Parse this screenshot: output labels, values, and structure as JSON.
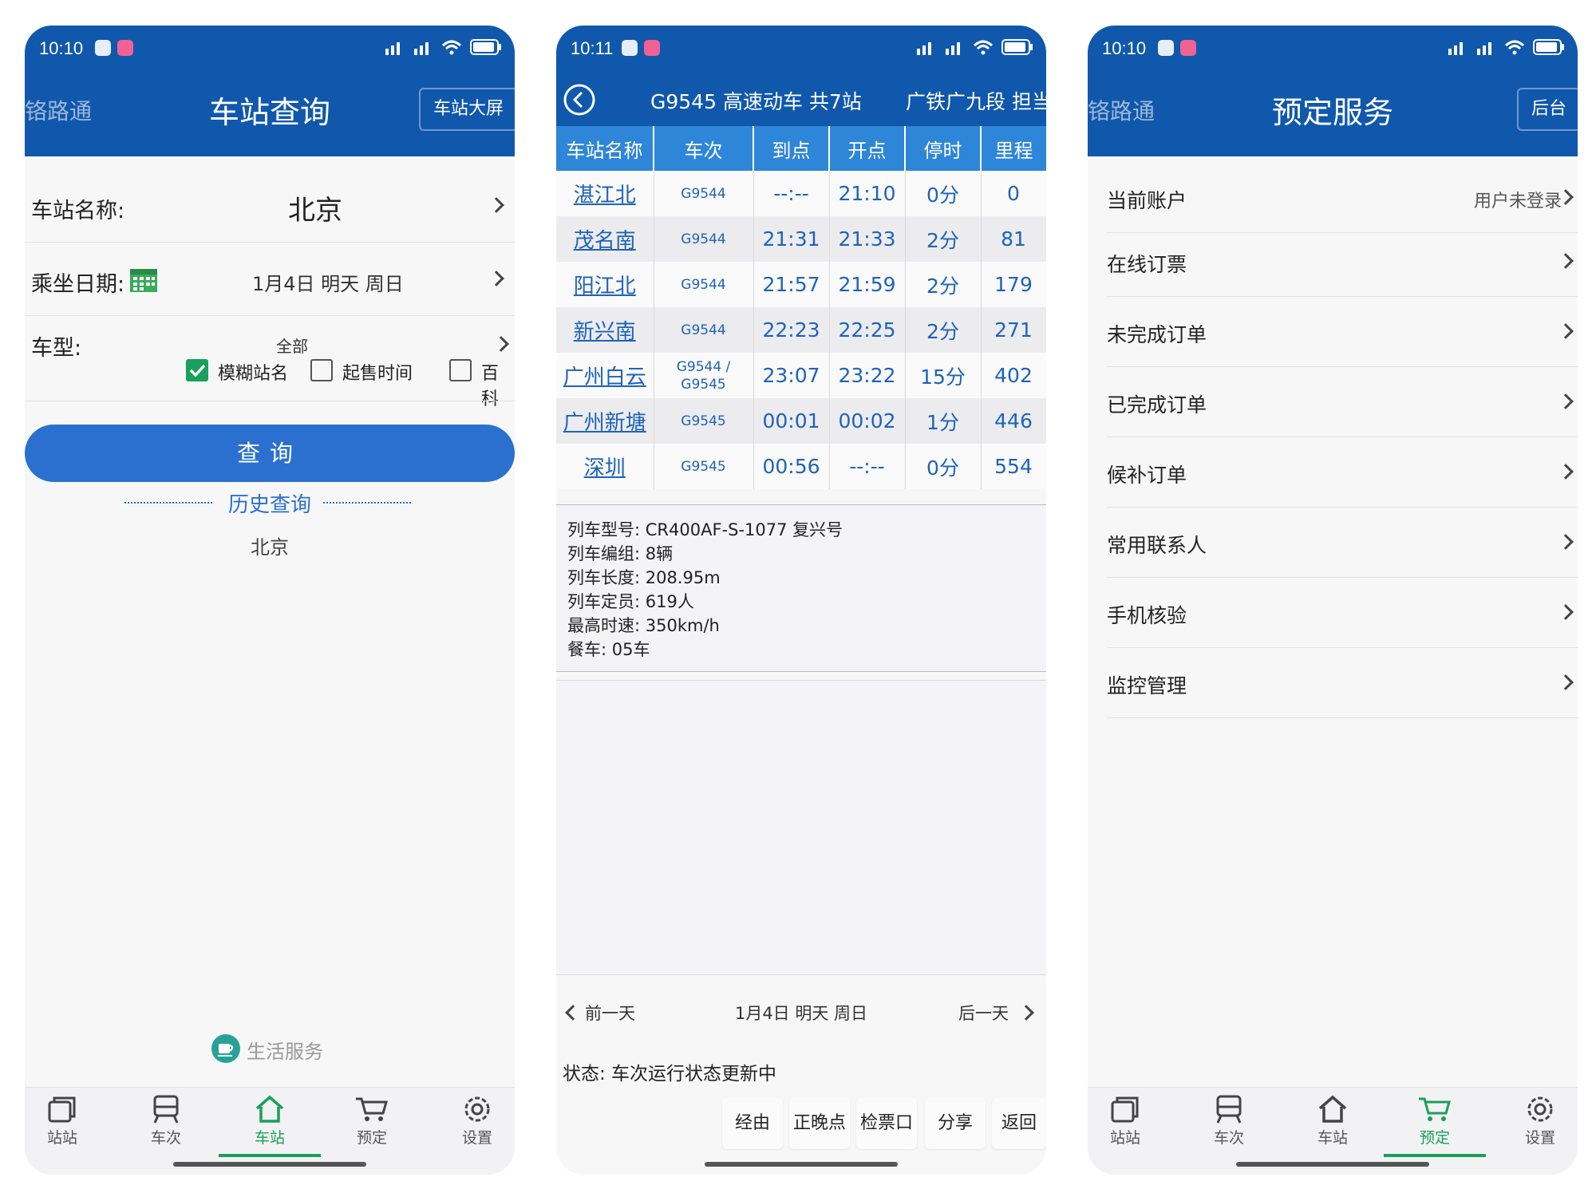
{
  "colors": {
    "header": "#1058ac",
    "accent_green": "#19a05a",
    "table_header": "#2e86d8",
    "query_button": "#2b70cf",
    "link_blue": "#1e63b9"
  },
  "nav": [
    "站站",
    "车次",
    "车站",
    "预定",
    "设置"
  ],
  "panel1": {
    "time": "10:10",
    "ghost_title": "铬路通",
    "title": "车站查询",
    "header_button": "车站大屏",
    "station_label": "车站名称:",
    "station_value": "北京",
    "date_label": "乘坐日期:",
    "date_value": "1月4日 明天 周日",
    "type_label": "车型:",
    "type_value": "全部",
    "checkboxes": [
      {
        "label": "模糊站名",
        "checked": true
      },
      {
        "label": "起售时间",
        "checked": false
      },
      {
        "label": "百科",
        "checked": false
      }
    ],
    "query_button": "查询",
    "history_title": "历史查询",
    "history_items": [
      "北京"
    ],
    "life_service": "生活服务",
    "active_nav": "车站"
  },
  "panel2": {
    "time": "10:11",
    "title": "G9545 高速动车 共7站",
    "subtitle": "广铁广九段 担当",
    "columns": [
      "车站名称",
      "车次",
      "到点",
      "开点",
      "停时",
      "里程"
    ],
    "rows": [
      {
        "station": "湛江北",
        "train": "G9544",
        "arrive": "--:--",
        "depart": "21:10",
        "stop": "0分",
        "km": "0"
      },
      {
        "station": "茂名南",
        "train": "G9544",
        "arrive": "21:31",
        "depart": "21:33",
        "stop": "2分",
        "km": "81"
      },
      {
        "station": "阳江北",
        "train": "G9544",
        "arrive": "21:57",
        "depart": "21:59",
        "stop": "2分",
        "km": "179"
      },
      {
        "station": "新兴南",
        "train": "G9544",
        "arrive": "22:23",
        "depart": "22:25",
        "stop": "2分",
        "km": "271"
      },
      {
        "station": "广州白云",
        "train": "G9544 / G9545",
        "arrive": "23:07",
        "depart": "23:22",
        "stop": "15分",
        "km": "402"
      },
      {
        "station": "广州新塘",
        "train": "G9545",
        "arrive": "00:01",
        "depart": "00:02",
        "stop": "1分",
        "km": "446"
      },
      {
        "station": "深圳",
        "train": "G9545",
        "arrive": "00:56",
        "depart": "--:--",
        "stop": "0分",
        "km": "554"
      }
    ],
    "info": [
      "列车型号: CR400AF-S-1077 复兴号",
      "列车编组: 8辆",
      "列车长度: 208.95m",
      "列车定员: 619人",
      "最高时速: 350km/h",
      "餐车: 05车"
    ],
    "prev_day": "前一天",
    "current_day": "1月4日 明天 周日",
    "next_day": "后一天",
    "status": "状态: 车次运行状态更新中",
    "actions": [
      "经由",
      "正晚点",
      "检票口",
      "分享",
      "返回"
    ]
  },
  "panel3": {
    "time": "10:10",
    "ghost_title": "铬路通",
    "title": "预定服务",
    "header_button": "后台",
    "menu": [
      {
        "label": "当前账户",
        "value": "用户未登录"
      },
      {
        "label": "在线订票",
        "value": ""
      },
      {
        "label": "未完成订单",
        "value": ""
      },
      {
        "label": "已完成订单",
        "value": ""
      },
      {
        "label": "候补订单",
        "value": ""
      },
      {
        "label": "常用联系人",
        "value": ""
      },
      {
        "label": "手机核验",
        "value": ""
      },
      {
        "label": "监控管理",
        "value": ""
      }
    ],
    "active_nav": "预定"
  }
}
